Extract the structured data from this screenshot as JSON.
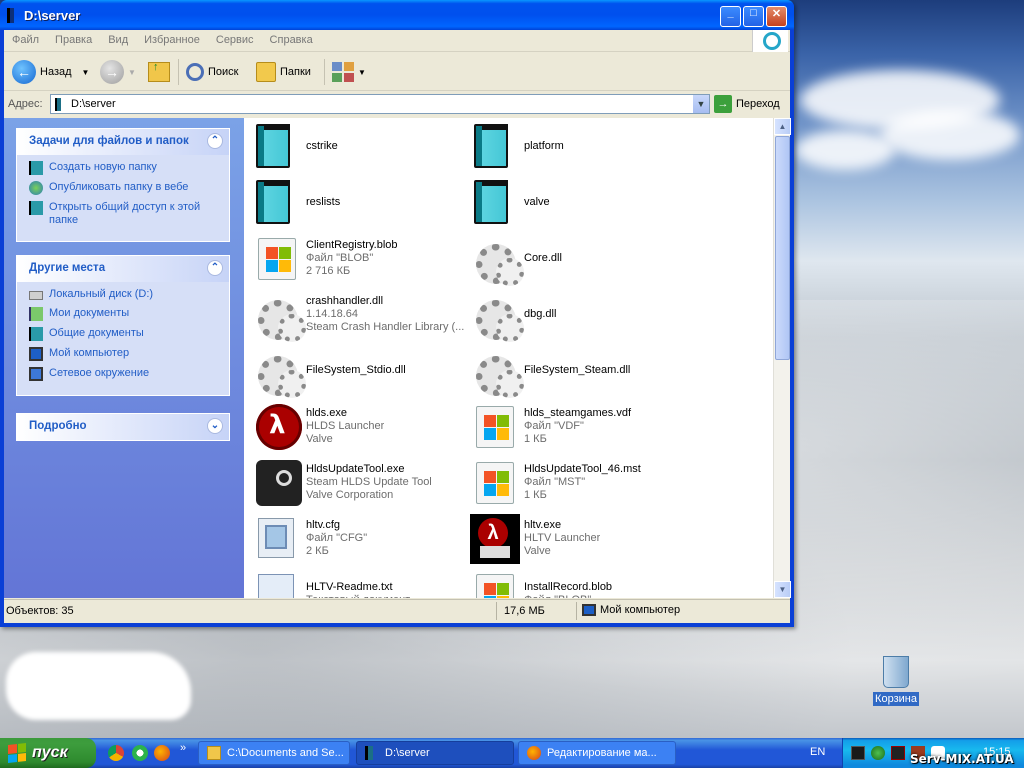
{
  "window": {
    "title": "D:\\server",
    "buttons": [
      "_",
      "□",
      "✕"
    ]
  },
  "menu": [
    "Файл",
    "Правка",
    "Вид",
    "Избранное",
    "Сервис",
    "Справка"
  ],
  "toolbar": {
    "back_label": "Назад",
    "search_label": "Поиск",
    "folders_label": "Папки"
  },
  "address": {
    "label": "Адрес:",
    "value": "D:\\server",
    "go_label": "Переход"
  },
  "panels": {
    "tasks": {
      "title": "Задачи для файлов и папок",
      "items": [
        "Создать новую папку",
        "Опубликовать папку в вебе",
        "Открыть общий доступ к этой папке"
      ]
    },
    "places": {
      "title": "Другие места",
      "items": [
        "Локальный диск (D:)",
        "Мои документы",
        "Общие документы",
        "Мой компьютер",
        "Сетевое окружение"
      ]
    },
    "details": {
      "title": "Подробно"
    }
  },
  "files": [
    {
      "name": "cstrike",
      "line2": "",
      "line3": "",
      "icon": "folder-icon"
    },
    {
      "name": "platform",
      "line2": "",
      "line3": "",
      "icon": "folder-icon"
    },
    {
      "name": "reslists",
      "line2": "",
      "line3": "",
      "icon": "folder-icon"
    },
    {
      "name": "valve",
      "line2": "",
      "line3": "",
      "icon": "folder-icon"
    },
    {
      "name": "ClientRegistry.blob",
      "line2": "Файл \"BLOB\"",
      "line3": "2 716 КБ",
      "icon": "windows-file-icon"
    },
    {
      "name": "Core.dll",
      "line2": "",
      "line3": "",
      "icon": "gear-file-icon"
    },
    {
      "name": "crashhandler.dll",
      "line2": "1.14.18.64",
      "line3": "Steam Crash Handler Library (...",
      "icon": "gear-file-icon"
    },
    {
      "name": "dbg.dll",
      "line2": "",
      "line3": "",
      "icon": "gear-file-icon"
    },
    {
      "name": "FileSystem_Stdio.dll",
      "line2": "",
      "line3": "",
      "icon": "gear-file-icon"
    },
    {
      "name": "FileSystem_Steam.dll",
      "line2": "",
      "line3": "",
      "icon": "gear-file-icon"
    },
    {
      "name": "hlds.exe",
      "line2": "HLDS Launcher",
      "line3": "Valve",
      "icon": "half-life-icon"
    },
    {
      "name": "hlds_steamgames.vdf",
      "line2": "Файл \"VDF\"",
      "line3": "1 КБ",
      "icon": "windows-file-icon"
    },
    {
      "name": "HldsUpdateTool.exe",
      "line2": "Steam HLDS Update Tool",
      "line3": "Valve Corporation",
      "icon": "steam-icon"
    },
    {
      "name": "HldsUpdateTool_46.mst",
      "line2": "Файл \"MST\"",
      "line3": "1 КБ",
      "icon": "windows-file-icon"
    },
    {
      "name": "hltv.cfg",
      "line2": "Файл \"CFG\"",
      "line3": "2 КБ",
      "icon": "config-file-icon"
    },
    {
      "name": "hltv.exe",
      "line2": "HLTV Launcher",
      "line3": "Valve",
      "icon": "hltv-icon"
    },
    {
      "name": "HLTV-Readme.txt",
      "line2": "Текстовый документ",
      "line3": "",
      "icon": "text-file-icon"
    },
    {
      "name": "InstallRecord.blob",
      "line2": "Файл \"BLOB\"",
      "line3": "",
      "icon": "windows-file-icon"
    }
  ],
  "status": {
    "objects": "Объектов: 35",
    "size": "17,6 МБ",
    "location": "Мой компьютер"
  },
  "desktop": {
    "recycle_label": "Корзина"
  },
  "taskbar": {
    "start_label": "пуск",
    "more": "»",
    "tasks": [
      "C:\\Documents and Se...",
      "D:\\server",
      "Редактирование ма..."
    ],
    "lang": "EN",
    "clock": "15:15"
  },
  "watermark": "Serv-MIX.AT.UA"
}
